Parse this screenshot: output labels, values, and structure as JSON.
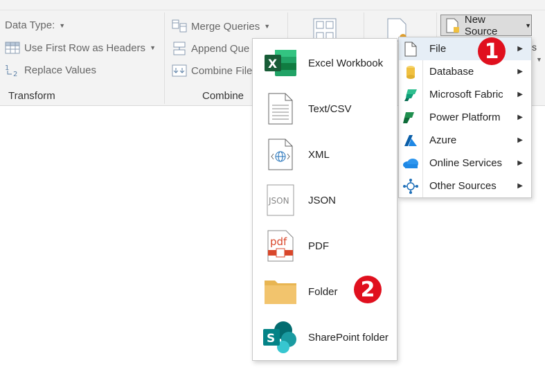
{
  "ribbon": {
    "data_type_label": "Data Type:",
    "first_row_label": "Use First Row as Headers",
    "replace_values_label": "Replace Values",
    "transform_group": "Transform",
    "merge_queries_label": "Merge Queries",
    "append_queries_label": "Append Que",
    "combine_files_label": "Combine File",
    "combine_group": "Combine",
    "new_source_label": "New Source",
    "right_peek": "s"
  },
  "source_menu": {
    "items": [
      {
        "label": "File",
        "icon": "file-icon"
      },
      {
        "label": "Database",
        "icon": "database-icon"
      },
      {
        "label": "Microsoft Fabric",
        "icon": "fabric-icon"
      },
      {
        "label": "Power Platform",
        "icon": "power-platform-icon"
      },
      {
        "label": "Azure",
        "icon": "azure-icon"
      },
      {
        "label": "Online Services",
        "icon": "cloud-icon"
      },
      {
        "label": "Other Sources",
        "icon": "network-icon"
      }
    ]
  },
  "file_menu": {
    "items": [
      {
        "label": "Excel Workbook",
        "icon": "excel-icon"
      },
      {
        "label": "Text/CSV",
        "icon": "text-file-icon"
      },
      {
        "label": "XML",
        "icon": "xml-icon"
      },
      {
        "label": "JSON",
        "icon": "json-icon"
      },
      {
        "label": "PDF",
        "icon": "pdf-icon"
      },
      {
        "label": "Folder",
        "icon": "folder-icon"
      },
      {
        "label": "SharePoint folder",
        "icon": "sharepoint-icon"
      }
    ]
  },
  "badges": {
    "one": "1",
    "two": "2"
  },
  "icon_glyphs": {
    "excel": "X",
    "json": "JSON",
    "pdf": "pdf",
    "sharepoint": "S"
  },
  "colors": {
    "badge": "#e0101e",
    "excel": "#1d6f42",
    "sharepoint": "#038387",
    "folder": "#f2c46d",
    "azure": "#0072c6",
    "fabric": "#0f9d76",
    "database": "#f0c040",
    "pdf": "#d9472b"
  }
}
